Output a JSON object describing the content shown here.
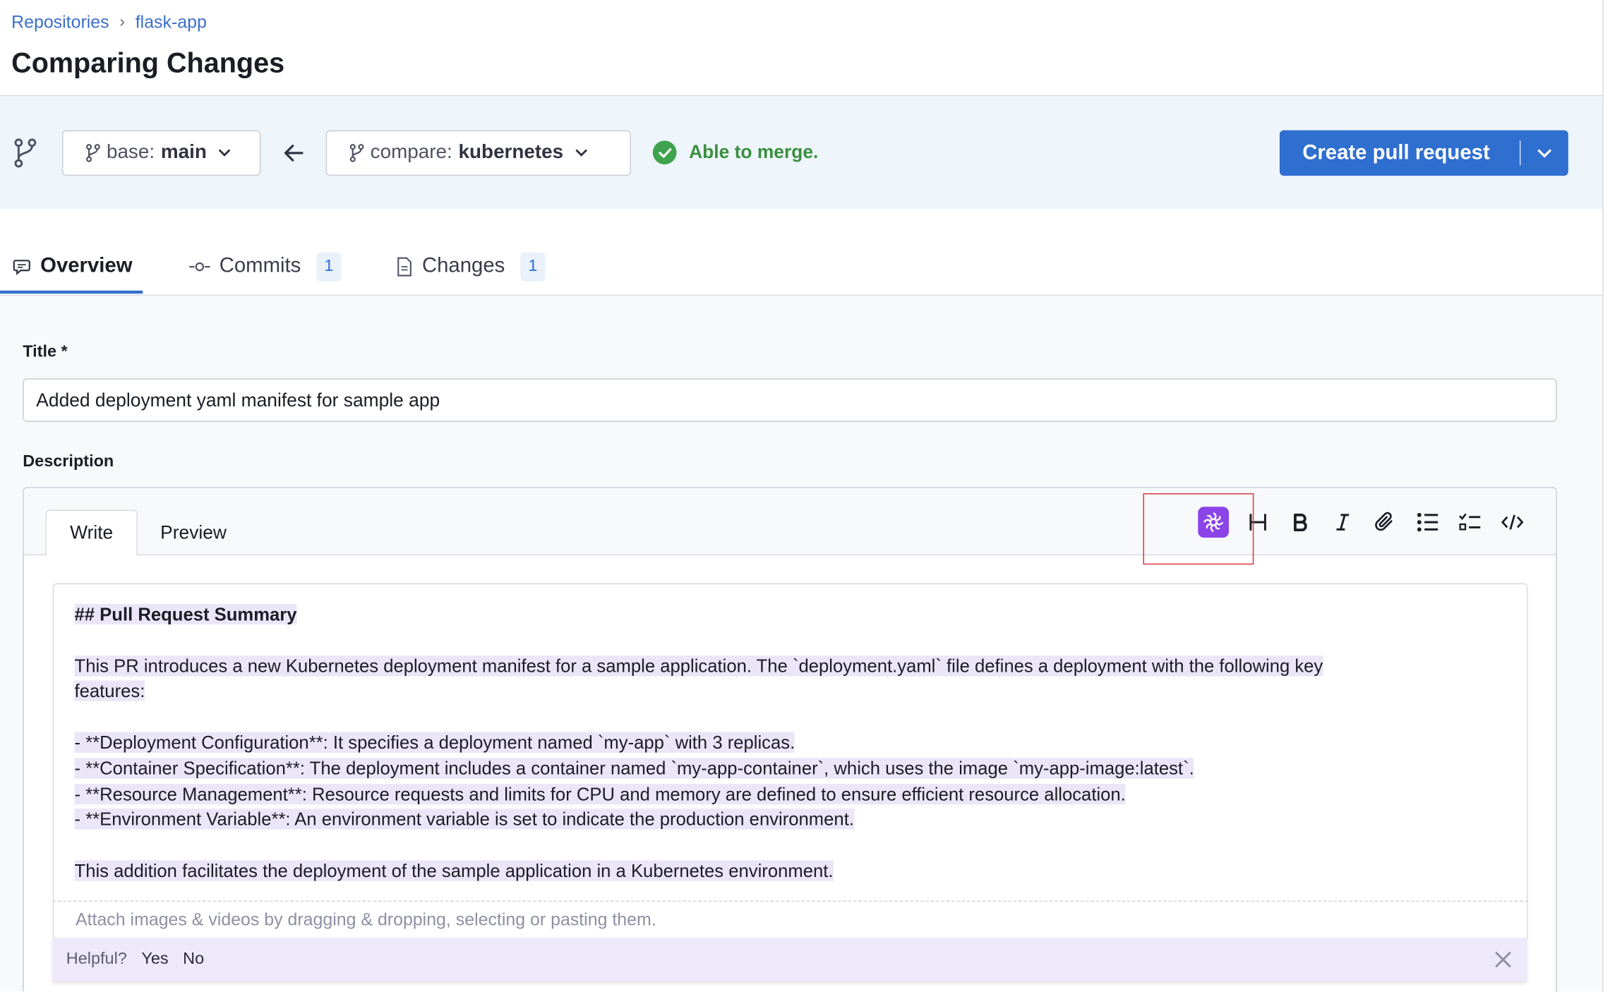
{
  "breadcrumb": {
    "root": "Repositories",
    "repo": "flask-app"
  },
  "page_title": "Comparing Changes",
  "compare": {
    "base_prefix": "base:",
    "base_branch": "main",
    "compare_prefix": "compare:",
    "compare_branch": "kubernetes",
    "merge_status": "Able to merge.",
    "create_button": "Create pull request"
  },
  "tabs": {
    "overview": "Overview",
    "commits": "Commits",
    "commits_count": "1",
    "changes": "Changes",
    "changes_count": "1"
  },
  "form": {
    "title_label": "Title *",
    "title_value": "Added deployment yaml manifest for sample app",
    "description_label": "Description",
    "write_tab": "Write",
    "preview_tab": "Preview",
    "description_lines": [
      "## Pull Request Summary",
      "This PR introduces a new Kubernetes deployment manifest for a sample application. The `deployment.yaml` file defines a deployment with the following key",
      "features:",
      "- **Deployment Configuration**: It specifies a deployment named `my-app` with 3 replicas.",
      "- **Container Specification**: The deployment includes a container named `my-app-container`, which uses the image `my-app-image:latest`.",
      "- **Resource Management**: Resource requests and limits for CPU and memory are defined to ensure efficient resource allocation.",
      "- **Environment Variable**: An environment variable is set to indicate the production environment.",
      "This addition facilitates the deployment of the sample application in a Kubernetes environment."
    ],
    "attach_hint": "Attach images & videos by dragging & dropping, selecting or pasting them."
  },
  "feedback": {
    "question": "Helpful?",
    "yes": "Yes",
    "no": "No"
  },
  "toolbar_icons": [
    "ai-assist-icon",
    "heading-icon",
    "bold-icon",
    "italic-icon",
    "attach-icon",
    "bullet-list-icon",
    "checklist-icon",
    "code-icon"
  ],
  "colors": {
    "primary": "#2f6fcf",
    "success": "#3a8f3f",
    "ai_purple": "#8b44e8",
    "ai_highlight": "#ebe6f7",
    "annotation_red": "#d9343a"
  }
}
